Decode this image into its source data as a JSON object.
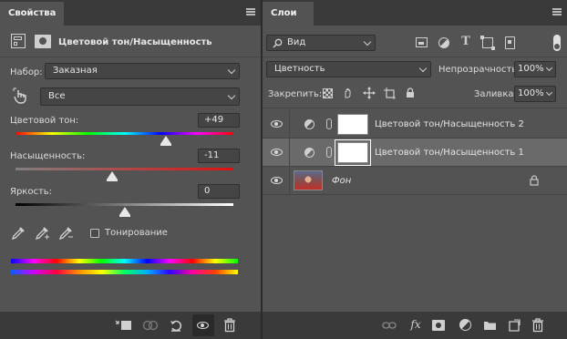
{
  "props": {
    "tab_title": "Свойства",
    "header_title": "Цветовой тон/Насыщенность",
    "preset_label": "Набор:",
    "preset_value": "Заказная",
    "channel_value": "Все",
    "hue_label": "Цветовой тон:",
    "hue_value": "+49",
    "hue_slider_level": 0.69,
    "saturation_label": "Насыщенность:",
    "saturation_value": "-11",
    "saturation_slider_level": 0.445,
    "lightness_label": "Яркость:",
    "lightness_value": "0",
    "lightness_slider_level": 0.5,
    "colorize_label": "Тонирование",
    "colorize_checked": false,
    "bottom_icons": [
      "clip-to-layer-icon",
      "view-previous-icon",
      "reset-icon",
      "visibility-icon",
      "trash-icon"
    ]
  },
  "layers": {
    "tab_title": "Слои",
    "filter_kind": "Вид",
    "blend_mode": "Цветность",
    "opacity_label": "Непрозрачность:",
    "opacity_value": "100%",
    "lock_label": "Закрепить:",
    "fill_label": "Заливка:",
    "fill_value": "100%",
    "items": [
      {
        "name": "Цветовой тон/Насыщенность 2",
        "type": "adjustment",
        "selected": false
      },
      {
        "name": "Цветовой тон/Насыщенность 1",
        "type": "adjustment",
        "selected": true
      },
      {
        "name": "Фон",
        "type": "background",
        "locked": true,
        "selected": false
      }
    ],
    "bottom_icons": [
      "link-icon",
      "fx-icon",
      "mask-icon",
      "adjustment-icon",
      "folder-icon",
      "new-layer-icon",
      "trash-icon"
    ]
  },
  "colors": {
    "panel_bg": "#535353",
    "tabbar_bg": "#3a3a3a",
    "selected_row": "#6a6a6a",
    "field_bg": "#454545"
  }
}
